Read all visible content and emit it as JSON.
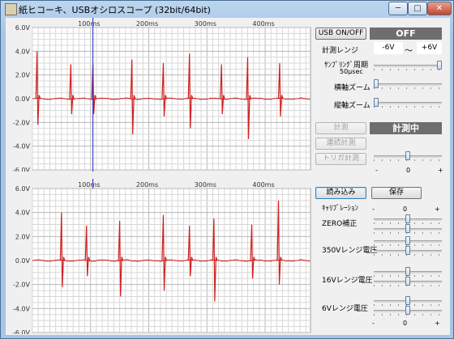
{
  "window": {
    "title": "紙ヒコーキ、USBオシロスコープ (32bit/64bit)",
    "minimize_glyph": "─",
    "maximize_glyph": "□",
    "close_glyph": "✕"
  },
  "plots": {
    "x_ticks": [
      "100ms",
      "200ms",
      "300ms",
      "400ms"
    ],
    "y_ticks": [
      "6.0V",
      "4.0V",
      "2.0V",
      "0.0V",
      "-2.0V",
      "-4.0V",
      "-6.0V"
    ],
    "trace_color": "#d02020",
    "cursor_color": "#2020c8",
    "grid_color": "#d8d8d8"
  },
  "chart_data": [
    {
      "type": "line",
      "name": "upper-trace",
      "x_unit": "ms",
      "ylim": [
        -6.0,
        6.0
      ],
      "xlim": [
        0,
        478
      ],
      "grid": true,
      "cursor_x": 104,
      "spikes": [
        {
          "x": 8,
          "up": 4.0,
          "down": -2.2
        },
        {
          "x": 66,
          "up": 2.9,
          "down": -1.3
        },
        {
          "x": 104,
          "up": 2.9,
          "down": -1.3
        },
        {
          "x": 171,
          "up": 3.3,
          "down": -3.0
        },
        {
          "x": 225,
          "up": 3.0,
          "down": -1.5
        },
        {
          "x": 270,
          "up": 3.8,
          "down": -2.5
        },
        {
          "x": 325,
          "up": 2.9,
          "down": -1.3
        },
        {
          "x": 370,
          "up": 3.5,
          "down": -3.4
        },
        {
          "x": 425,
          "up": 3.0,
          "down": -1.5
        }
      ]
    },
    {
      "type": "line",
      "name": "lower-trace",
      "x_unit": "ms",
      "ylim": [
        -6.0,
        6.0
      ],
      "xlim": [
        0,
        478
      ],
      "grid": true,
      "spikes": [
        {
          "x": 50,
          "up": 4.0,
          "down": -2.2
        },
        {
          "x": 93,
          "up": 2.9,
          "down": -1.3
        },
        {
          "x": 150,
          "up": 3.3,
          "down": -3.0
        },
        {
          "x": 225,
          "up": 3.8,
          "down": -2.5
        },
        {
          "x": 270,
          "up": 2.9,
          "down": -1.3
        },
        {
          "x": 312,
          "up": 3.5,
          "down": -3.4
        },
        {
          "x": 377,
          "up": 3.0,
          "down": -1.5
        },
        {
          "x": 423,
          "up": 5.0,
          "down": -2.0
        }
      ]
    }
  ],
  "panel": {
    "usb_button": "USB ON/OFF",
    "usb_status": "OFF",
    "range_label": "計測レンジ",
    "range_min": "-6V",
    "range_sep": "〜",
    "range_max": "+6V",
    "sampling_label": "ｻﾝﾌﾟﾘﾝｸﾞ周期",
    "sampling_value": "50μsec",
    "sampling_level": 1.0,
    "hzoom_label": "横軸ズーム",
    "hzoom_level": 0.0,
    "vzoom_label": "縦軸ズーム",
    "vzoom_level": 0.0,
    "measure_button": "計測",
    "measure_status": "計測中",
    "continuous_button": "連続計測",
    "trigger_button": "トリガ計測",
    "trigger_level": 0.5,
    "trigger_minus": "-",
    "trigger_zero": "0",
    "trigger_plus": "+",
    "load_button": "読み込み",
    "save_button": "保存",
    "calib_label": "ｷｬﾘﾌﾞﾚｰｼｮﾝ",
    "calib_minus": "-",
    "calib_zero": "0",
    "calib_plus": "+",
    "zero_label": "ZERO補正",
    "v350_label": "350Vレンジ電圧",
    "v16_label": "16Vレンジ電圧",
    "v6_label": "6Vレンジ電圧",
    "bottom_minus": "-",
    "bottom_zero": "0",
    "bottom_plus": "+"
  }
}
